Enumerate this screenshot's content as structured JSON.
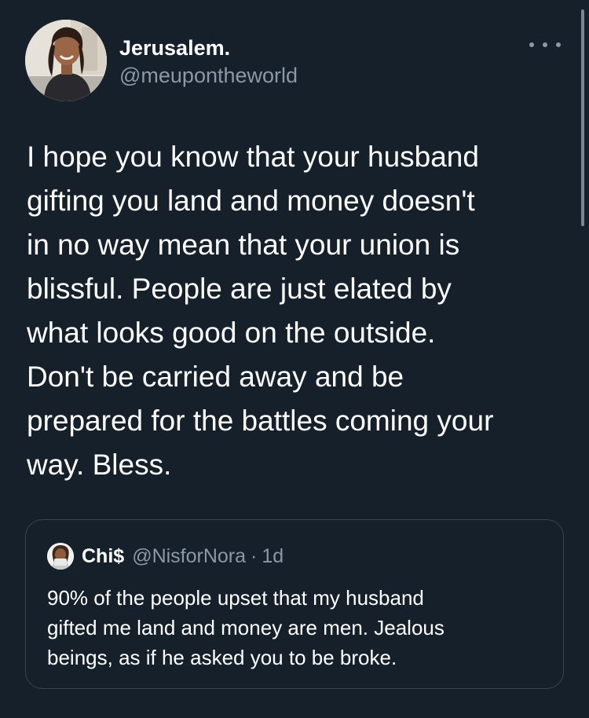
{
  "tweet": {
    "author": {
      "display_name": "Jerusalem.",
      "handle": "@meupontheworld"
    },
    "more_icon": "more-horizontal-icon",
    "text_lines": [
      "I hope you know that your husband",
      "gifting you land and money doesn't",
      "in no way mean that your union is",
      "blissful. People are just elated by",
      "what looks good on the outside.",
      "Don't be carried away and be",
      "prepared for the battles coming your",
      "way. Bless."
    ]
  },
  "quote": {
    "author": {
      "display_name": "Chi$",
      "handle": "@NisforNora",
      "separator": "·",
      "time": "1d"
    },
    "text_lines": [
      "90% of the people upset that my husband",
      "gifted me land and money are men. Jealous",
      "beings, as if he asked you to be broke."
    ]
  },
  "colors": {
    "background": "#15202b",
    "text": "#ffffff",
    "secondary_text": "#8b98a5",
    "border": "#38444d"
  }
}
